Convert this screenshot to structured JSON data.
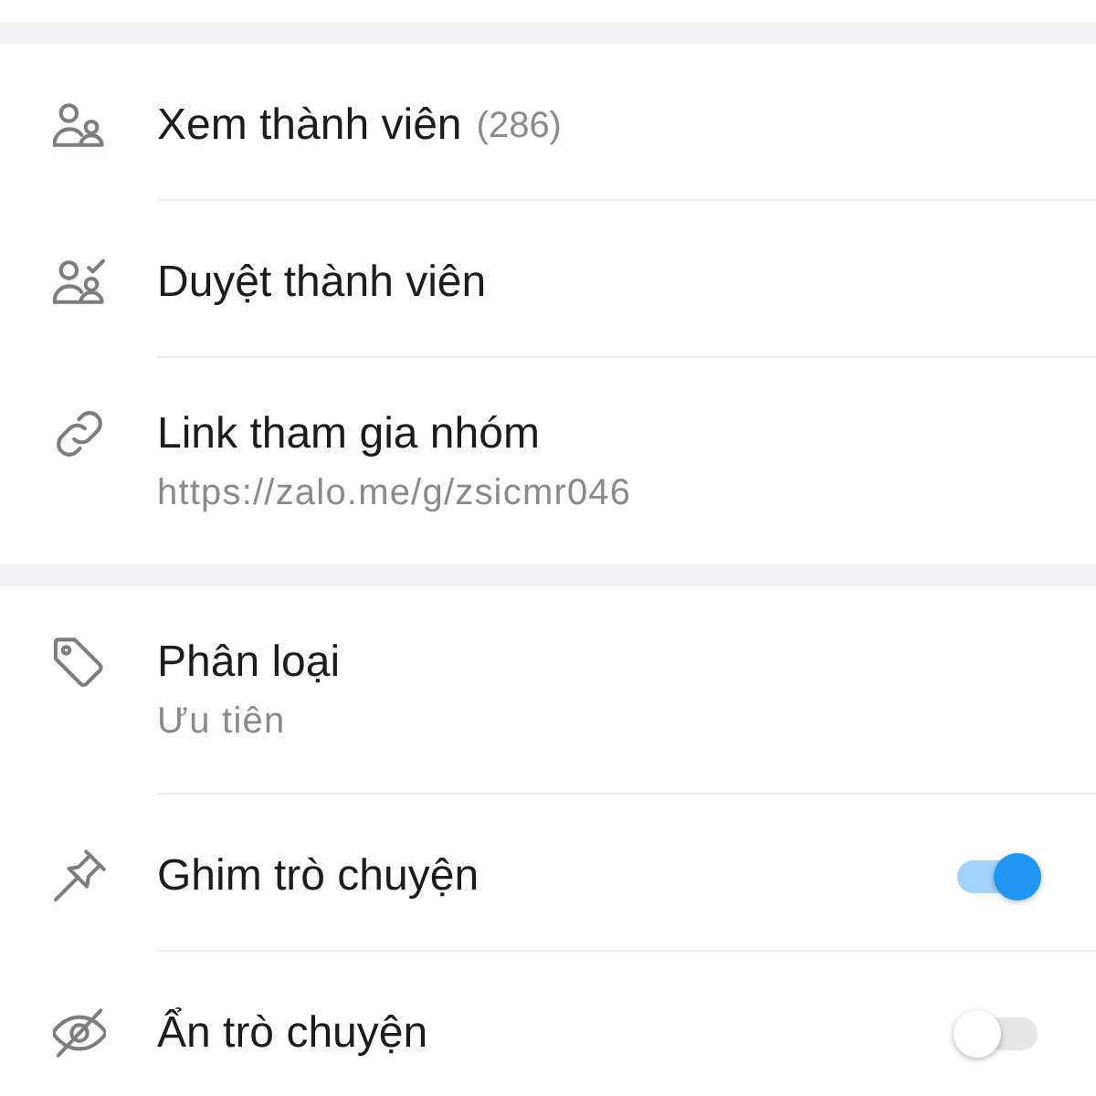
{
  "sections": [
    {
      "items": [
        {
          "kind": "nav",
          "label": "Xem thành viên",
          "count": "(286)"
        },
        {
          "kind": "nav",
          "label": "Duyệt thành viên"
        },
        {
          "kind": "nav",
          "label": "Link tham gia nhóm",
          "subtitle": "https://zalo.me/g/zsicmr046"
        }
      ]
    },
    {
      "items": [
        {
          "kind": "nav",
          "label": "Phân loại",
          "subtitle": "Ưu tiên"
        },
        {
          "kind": "toggle",
          "label": "Ghim trò chuyện",
          "on": true
        },
        {
          "kind": "toggle",
          "label": "Ẩn trò chuyện",
          "on": false
        }
      ]
    }
  ]
}
